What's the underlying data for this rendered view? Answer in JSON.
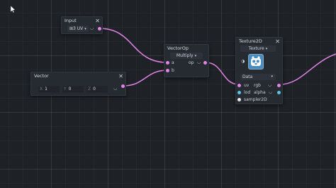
{
  "colors": {
    "wire": "#e283e6",
    "port_vec": "#e283e6",
    "port_float": "#5cc3e6",
    "port_sampler": "#e8e8e8"
  },
  "input_node": {
    "title": "Input",
    "mode_label": "UV",
    "mode_glyph": "⊞3"
  },
  "vector_node": {
    "title": "Vector",
    "fields": [
      {
        "label": "X",
        "value": "1"
      },
      {
        "label": "Y",
        "value": "0"
      },
      {
        "label": "Z",
        "value": "0"
      }
    ]
  },
  "vectorop_node": {
    "title": "VectorOp",
    "operation": "Multiply",
    "input_a": "a",
    "input_b": "b",
    "output": "op"
  },
  "texture_node": {
    "title": "Texture2D",
    "source": "Texture",
    "type": "Data",
    "inputs": [
      "uv",
      "lod",
      "sampler2D"
    ],
    "outputs": [
      "rgb",
      "alpha"
    ]
  }
}
